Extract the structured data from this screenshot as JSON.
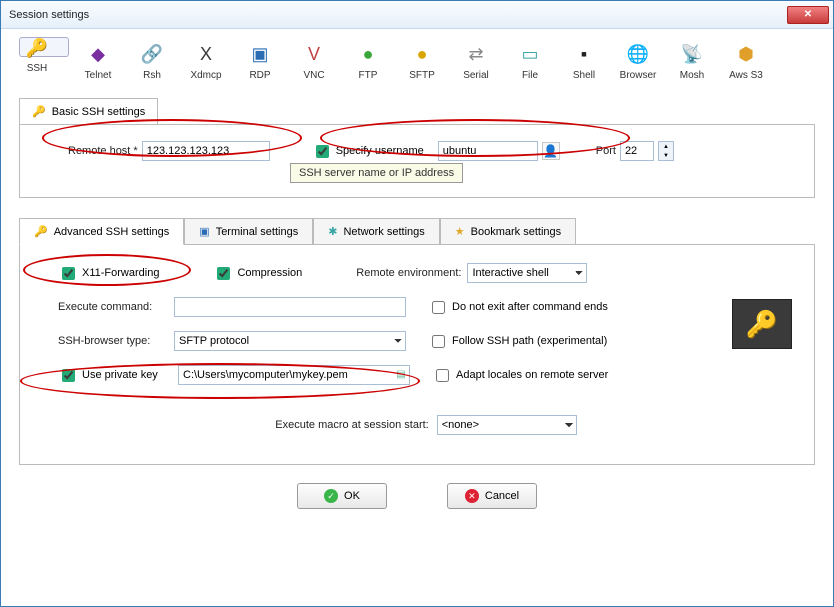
{
  "window": {
    "title": "Session settings"
  },
  "toolbar": [
    {
      "label": "SSH",
      "glyph": "🔑",
      "color": "#d9a600",
      "selected": true
    },
    {
      "label": "Telnet",
      "glyph": "◆",
      "color": "#7a2fa0"
    },
    {
      "label": "Rsh",
      "glyph": "🔗",
      "color": "#a06a2f"
    },
    {
      "label": "Xdmcp",
      "glyph": "X",
      "color": "#3a3a3a"
    },
    {
      "label": "RDP",
      "glyph": "▣",
      "color": "#2a6db5"
    },
    {
      "label": "VNC",
      "glyph": "V",
      "color": "#c14242"
    },
    {
      "label": "FTP",
      "glyph": "●",
      "color": "#3aa63a"
    },
    {
      "label": "SFTP",
      "glyph": "●",
      "color": "#d9a600"
    },
    {
      "label": "Serial",
      "glyph": "⇄",
      "color": "#888"
    },
    {
      "label": "File",
      "glyph": "▭",
      "color": "#3aa6a6"
    },
    {
      "label": "Shell",
      "glyph": "▪",
      "color": "#222"
    },
    {
      "label": "Browser",
      "glyph": "🌐",
      "color": "#2a9de0"
    },
    {
      "label": "Mosh",
      "glyph": "📡",
      "color": "#5b8"
    },
    {
      "label": "Aws S3",
      "glyph": "⬢",
      "color": "#e09e2a"
    }
  ],
  "basic": {
    "tab_icon": "🔑",
    "tab_label": "Basic SSH settings",
    "remote_host_label": "Remote host *",
    "remote_host_value": "123.123.123.123",
    "tooltip": "SSH server name or IP address",
    "specify_username_label": "Specify username",
    "specify_username_checked": true,
    "username_value": "ubuntu",
    "port_label": "Port",
    "port_value": "22"
  },
  "tabs2": [
    {
      "icon": "🔑",
      "label": "Advanced SSH settings",
      "active": true,
      "icon_color": "#d9a600"
    },
    {
      "icon": "▣",
      "label": "Terminal settings",
      "icon_color": "#2a6db5"
    },
    {
      "icon": "✱",
      "label": "Network settings",
      "icon_color": "#3aa6a6"
    },
    {
      "icon": "★",
      "label": "Bookmark settings",
      "icon_color": "#e0a82a"
    }
  ],
  "adv": {
    "x11_label": "X11-Forwarding",
    "x11_checked": true,
    "compression_label": "Compression",
    "compression_checked": true,
    "remote_env_label": "Remote environment:",
    "remote_env_value": "Interactive shell",
    "exec_cmd_label": "Execute command:",
    "exec_cmd_value": "",
    "no_exit_label": "Do not exit after command ends",
    "no_exit_checked": false,
    "browser_type_label": "SSH-browser type:",
    "browser_type_value": "SFTP protocol",
    "follow_path_label": "Follow SSH path (experimental)",
    "follow_path_checked": false,
    "private_key_label": "Use private key",
    "private_key_checked": true,
    "private_key_value": "C:\\Users\\mycomputer\\mykey.pem",
    "adapt_locales_label": "Adapt locales on remote server",
    "adapt_locales_checked": false,
    "macro_label": "Execute macro at session start:",
    "macro_value": "<none>"
  },
  "buttons": {
    "ok": "OK",
    "cancel": "Cancel"
  }
}
